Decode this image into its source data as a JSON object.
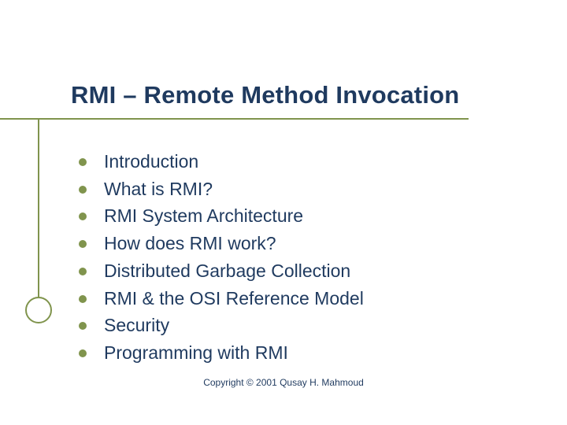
{
  "title": "RMI – Remote Method Invocation",
  "bullets": [
    "Introduction",
    "What is RMI?",
    "RMI System Architecture",
    "How does RMI work?",
    "Distributed Garbage Collection",
    "RMI & the OSI Reference Model",
    "Security",
    "Programming with RMI"
  ],
  "footer": "Copyright © 2001 Qusay H. Mahmoud"
}
